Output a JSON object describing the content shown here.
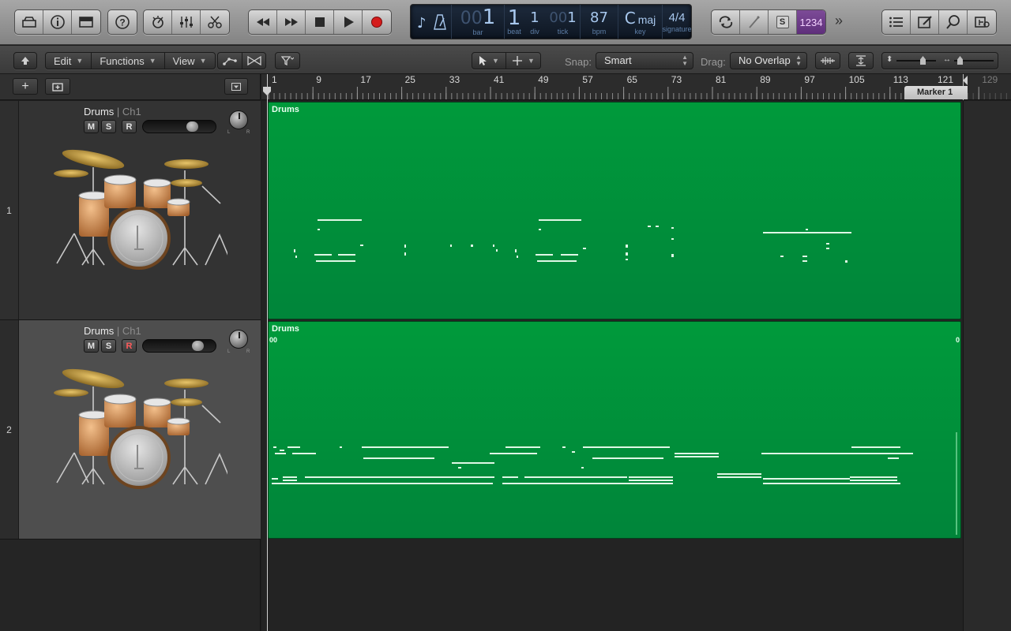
{
  "control_bar": {
    "left_buttons": [
      "library-icon",
      "inspector-icon",
      "toolbar-icon"
    ],
    "help_button": "help-icon",
    "view_buttons": [
      "smart-controls-icon",
      "mixer-icon",
      "editors-icon"
    ],
    "transport": [
      "rewind-icon",
      "fast-forward-icon",
      "stop-icon",
      "play-icon",
      "record-icon"
    ],
    "lcd": {
      "bar": "1",
      "bar_dim": "00",
      "beat": "1",
      "div": "1",
      "tick": "1",
      "tick_dim": "00",
      "bpm": "87",
      "key_root": "C",
      "key_mode": "maj",
      "sig_num": "4",
      "sig_den": "4",
      "labels": {
        "bar": "bar",
        "beat": "beat",
        "div": "div",
        "tick": "tick",
        "bpm": "bpm",
        "key": "key",
        "signature": "signature"
      }
    },
    "right_buttons": [
      "cycle-icon",
      "tuner-icon",
      "solo-icon",
      "count-in-icon"
    ],
    "solo_label": "S",
    "count_in_label": "1234",
    "more_label": "»",
    "far_right_buttons": [
      "list-editors-icon",
      "note-pad-icon",
      "loop-browser-icon",
      "browsers-icon"
    ]
  },
  "local_bar": {
    "menus": [
      {
        "label": "Edit"
      },
      {
        "label": "Functions"
      },
      {
        "label": "View"
      }
    ],
    "snap_label": "Snap:",
    "snap_value": "Smart",
    "drag_label": "Drag:",
    "drag_value": "No Overlap"
  },
  "ruler": {
    "bars": [
      "1",
      "9",
      "17",
      "25",
      "33",
      "41",
      "49",
      "57",
      "65",
      "73",
      "81",
      "89",
      "97",
      "105",
      "113",
      "121",
      "129"
    ],
    "marker": "Marker 1"
  },
  "tracks": [
    {
      "number": "1",
      "name": "Drums",
      "channel": "Ch1",
      "mute": "M",
      "solo": "S",
      "record": "R",
      "record_armed": false,
      "volume": 0.72,
      "pan_left": "L",
      "pan_right": "R"
    },
    {
      "number": "2",
      "name": "Drums",
      "channel": "Ch1",
      "mute": "M",
      "solo": "S",
      "record": "R",
      "record_armed": true,
      "volume": 0.81,
      "pan_left": "L",
      "pan_right": "R"
    }
  ],
  "regions": [
    {
      "name": "Drums"
    },
    {
      "name": "Drums",
      "loop_start_label": "00",
      "loop_end_label": "0"
    }
  ],
  "colors": {
    "region": "#00953b",
    "accent": "#5f2f7b",
    "lcd_text": "#a8c8ee"
  }
}
